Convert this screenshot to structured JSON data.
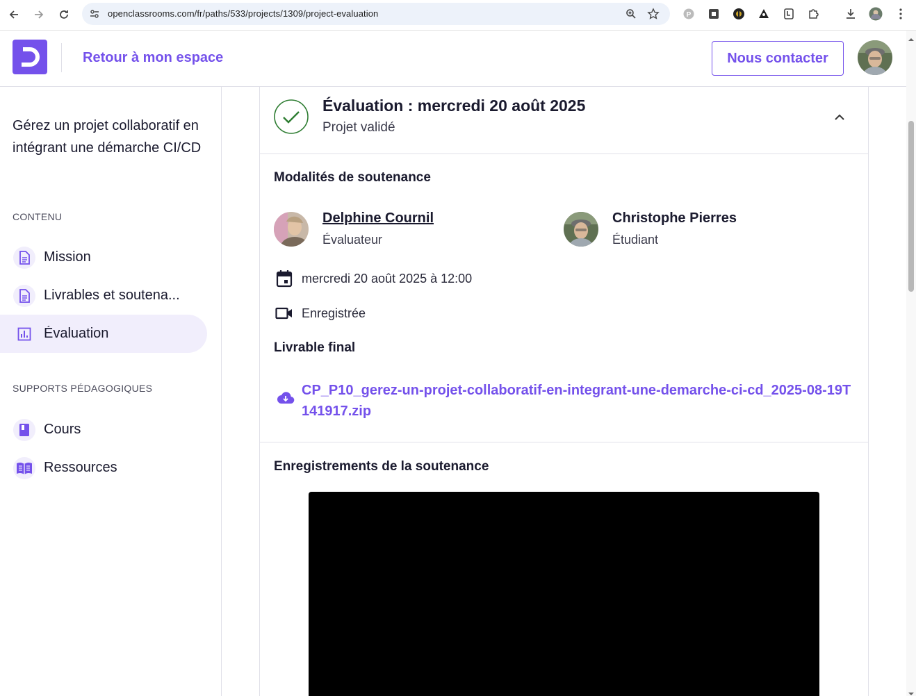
{
  "browser": {
    "url": "openclassrooms.com/fr/paths/533/projects/1309/project-evaluation",
    "icons": [
      "back-icon",
      "forward-icon",
      "reload-icon",
      "site-info-icon",
      "zoom-icon",
      "bookmark-star-icon",
      "extension-icons",
      "puzzle-icon",
      "download-icon",
      "profile-icon",
      "menu-icon"
    ]
  },
  "header": {
    "back_link": "Retour à mon espace",
    "contact_button": "Nous contacter"
  },
  "sidebar": {
    "project_title": "Gérez un projet collaboratif en intégrant une démarche CI/CD",
    "content_label": "CONTENU",
    "content_items": [
      {
        "label": "Mission",
        "icon": "document-icon",
        "active": false
      },
      {
        "label": "Livrables et soutena...",
        "icon": "document-icon",
        "active": false
      },
      {
        "label": "Évaluation",
        "icon": "chart-icon",
        "active": true
      }
    ],
    "support_label": "SUPPORTS PÉDAGOGIQUES",
    "support_items": [
      {
        "label": "Cours",
        "icon": "book-icon"
      },
      {
        "label": "Ressources",
        "icon": "open-book-icon"
      }
    ]
  },
  "evaluation": {
    "title": "Évaluation : mercredi 20 août 2025",
    "status": "Projet validé",
    "modalities_heading": "Modalités de soutenance",
    "evaluator": {
      "name": "Delphine Cournil",
      "role": "Évaluateur"
    },
    "student": {
      "name": "Christophe Pierres",
      "role": "Étudiant"
    },
    "date": "mercredi 20 août 2025 à 12:00",
    "recording": "Enregistrée",
    "deliverable_heading": "Livrable final",
    "deliverable_file": "CP_P10_gerez-un-projet-collaboratif-en-integrant-une-demarche-ci-cd_2025-08-19T141917.zip",
    "recordings_heading": "Enregistrements de la soutenance"
  },
  "colors": {
    "brand": "#7451eb",
    "success": "#2e7d32",
    "active_bg": "#f1eefc"
  }
}
